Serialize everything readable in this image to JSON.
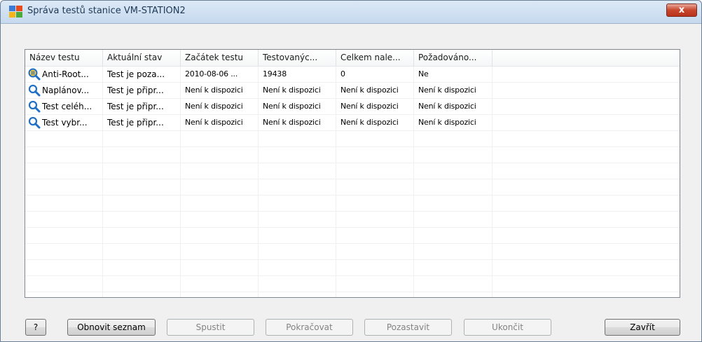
{
  "window": {
    "title": "Správa testů stanice VM-STATION2",
    "close_label": "x"
  },
  "columns": [
    "Název testu",
    "Aktuální stav",
    "Začátek testu",
    "Testovanýc...",
    "Celkem nale...",
    "Požadováno...",
    ""
  ],
  "rows": [
    {
      "icon": "paused-scan-icon",
      "cells": [
        "Anti-Root...",
        "Test je poza...",
        "2010-08-06 ...",
        "19438",
        "0",
        "Ne"
      ]
    },
    {
      "icon": "magnifier-icon",
      "cells": [
        "Naplánov...",
        "Test je připr...",
        "Není k dispozici",
        "Není k dispozici",
        "Není k dispozici",
        "Není k dispozici"
      ]
    },
    {
      "icon": "magnifier-icon",
      "cells": [
        "Test celéh...",
        "Test je připr...",
        "Není k dispozici",
        "Není k dispozici",
        "Není k dispozici",
        "Není k dispozici"
      ]
    },
    {
      "icon": "magnifier-icon",
      "cells": [
        "Test vybr...",
        "Test je připr...",
        "Není k dispozici",
        "Není k dispozici",
        "Není k dispozici",
        "Není k dispozici"
      ]
    }
  ],
  "buttons": {
    "help": "?",
    "refresh": "Obnovit seznam",
    "start": "Spustit",
    "resume": "Pokračovat",
    "pause": "Pozastavit",
    "stop": "Ukončit",
    "close": "Zavřít"
  },
  "colors": {
    "titlebar": "#c6d9ee",
    "close_button": "#c7462d",
    "icon_blue": "#1f6fc4"
  }
}
